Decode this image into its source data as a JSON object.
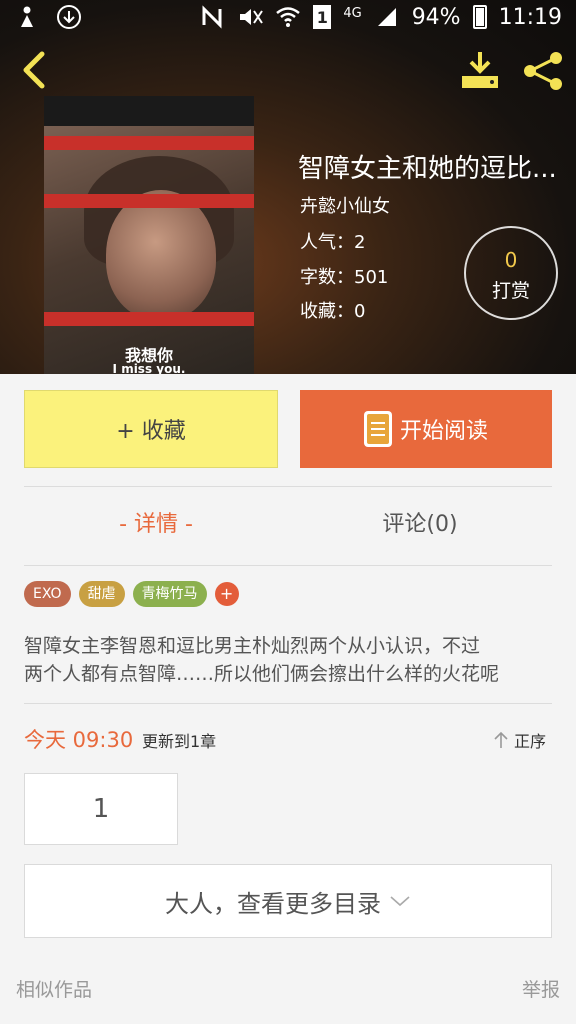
{
  "status_bar": {
    "battery": "94%",
    "time": "11:19",
    "network": "4G",
    "sim": "1"
  },
  "book": {
    "title": "智障女主和她的逗比...",
    "author": "卉懿小仙女",
    "popularity": "人气：2",
    "word_count": "字数：501",
    "favorites": "收藏：0",
    "cover_caption_cn": "我想你",
    "cover_caption_en": "I miss you."
  },
  "tip": {
    "count": "0",
    "label": "打赏"
  },
  "actions": {
    "favorite": "+ 收藏",
    "start_reading": "开始阅读"
  },
  "tabs": {
    "detail": "- 详情 -",
    "comments": "评论(0)"
  },
  "tags": [
    {
      "label": "EXO",
      "color": "#c06a4e"
    },
    {
      "label": "甜虐",
      "color": "#c8a042"
    },
    {
      "label": "青梅竹马",
      "color": "#8cb04e"
    }
  ],
  "tag_add": "+",
  "summary": [
    "智障女主李智恩和逗比男主朴灿烈两个从小认识，不过",
    "两个人都有点智障……所以他们俩会擦出什么样的火花呢"
  ],
  "update": {
    "time": "今天 09:30",
    "text": "更新到1章",
    "sort": "正序"
  },
  "chapter_number": "1",
  "more_catalog": "大人，查看更多目录",
  "footer": {
    "similar": "相似作品",
    "report": "举报"
  },
  "colors": {
    "accent": "#e8693c",
    "favorite_bg": "#fbf27c",
    "header_icon": "#f3e255"
  }
}
